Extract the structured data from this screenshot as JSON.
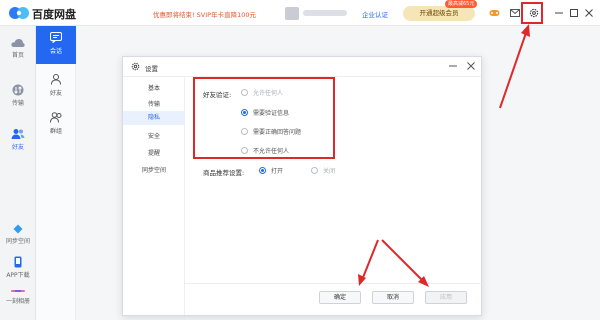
{
  "app": {
    "title": "百度网盘"
  },
  "header": {
    "promo": "优惠即将结束! SVIP年卡直降100元",
    "enterprise": "企业认证",
    "vip_button": "开通超级会员",
    "vip_badge": "最高减65元"
  },
  "leftnav": {
    "items": [
      {
        "label": "首页",
        "icon": "cloud-icon"
      },
      {
        "label": "传输",
        "icon": "transfer-icon"
      },
      {
        "label": "好友",
        "icon": "friends-icon",
        "active": true
      },
      {
        "label": "同步空间",
        "icon": "sync-space-icon"
      },
      {
        "label": "APP下载",
        "icon": "phone-icon"
      },
      {
        "label": "一刻相册",
        "icon": "album-icon"
      }
    ]
  },
  "subnav": {
    "items": [
      {
        "label": "会话",
        "icon": "chat-icon",
        "active": true
      },
      {
        "label": "好友",
        "icon": "person-icon"
      },
      {
        "label": "群组",
        "icon": "group-icon"
      }
    ]
  },
  "dialog": {
    "title": "设置",
    "sidebar": [
      "基本",
      "传输",
      "隐私",
      "安全",
      "提醒",
      "同步空间"
    ],
    "active_index": 2,
    "friend_verify": {
      "label": "好友验证:",
      "options": [
        {
          "label": "允许任何人",
          "selected": false
        },
        {
          "label": "需要验证信息",
          "selected": true
        },
        {
          "label": "需要正确回答问题",
          "selected": false
        },
        {
          "label": "不允许任何人",
          "selected": false
        }
      ]
    },
    "product_recommend": {
      "label": "商品推荐设置:",
      "options": [
        {
          "label": "打开",
          "selected": true
        },
        {
          "label": "关闭",
          "selected": false
        }
      ]
    },
    "buttons": {
      "ok": "确定",
      "cancel": "取消",
      "apply": "应用"
    }
  },
  "colors": {
    "accent": "#2468f2",
    "highlight": "#e0282a",
    "promo": "#e0572e"
  }
}
